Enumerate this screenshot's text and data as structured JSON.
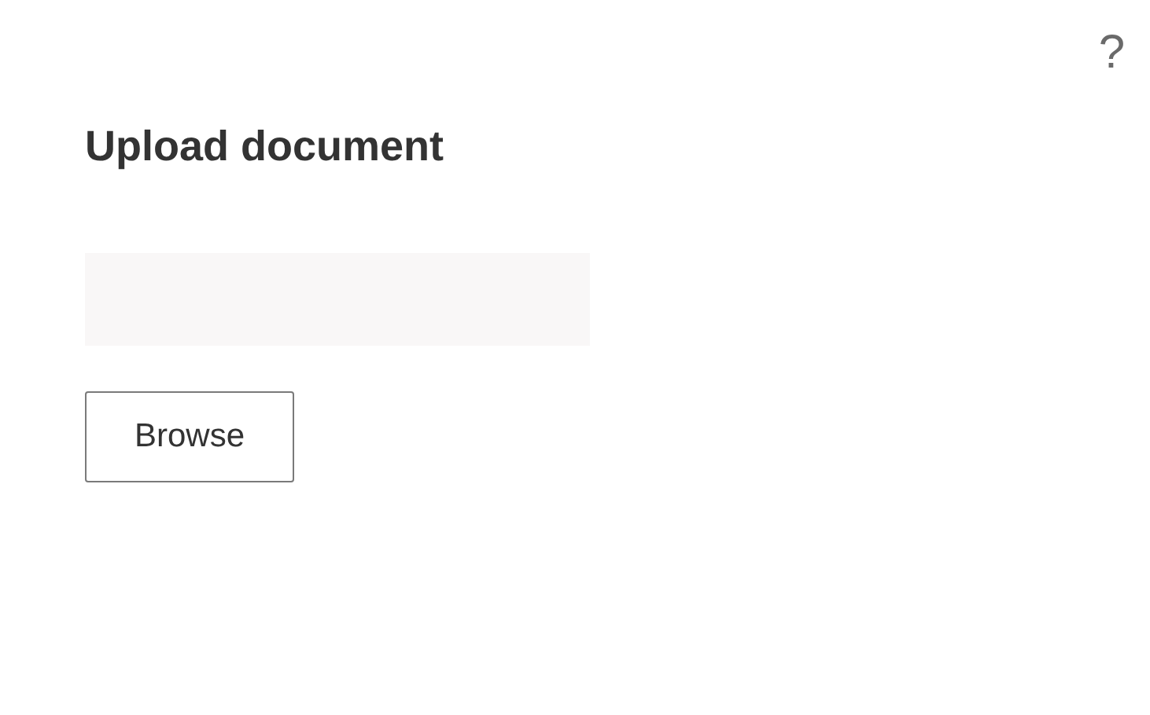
{
  "help": "?",
  "title": "Upload document",
  "browse_button": "Browse"
}
